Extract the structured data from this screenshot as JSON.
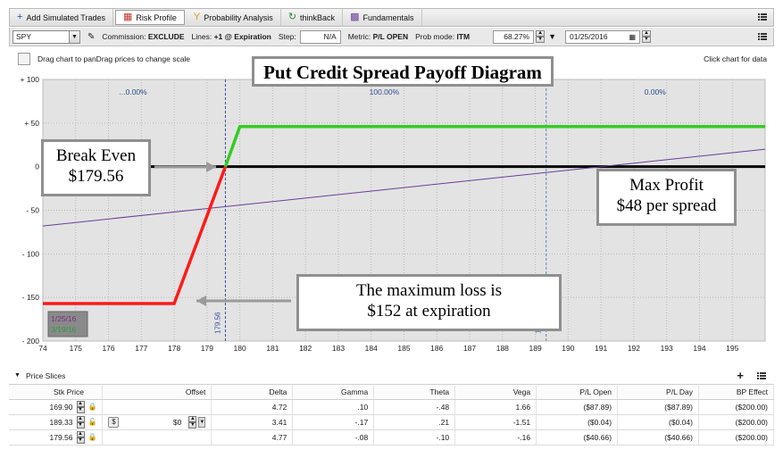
{
  "tabs": [
    {
      "label": "Add Simulated Trades",
      "icon": "plus-icon",
      "color": "#1f4fa8"
    },
    {
      "label": "Risk Profile",
      "icon": "risk-profile-icon",
      "color": "#c0392b"
    },
    {
      "label": "Probability Analysis",
      "icon": "probability-icon",
      "color": "#d4a017"
    },
    {
      "label": "thinkBack",
      "icon": "thinkback-icon",
      "color": "#2e8b3a"
    },
    {
      "label": "Fundamentals",
      "icon": "fundamentals-icon",
      "color": "#6a3d9a"
    }
  ],
  "toolbar": {
    "symbol": "SPY",
    "commission_label": "Commission:",
    "commission_value": "EXCLUDE",
    "lines_label": "Lines:",
    "lines_value": "+1 @ Expiration",
    "step_label": "Step:",
    "step_value": "N/A",
    "metric_label": "Metric:",
    "metric_value": "P/L OPEN",
    "prob_label": "Prob mode:",
    "prob_value": "ITM",
    "volatility": "68.27%",
    "date": "01/25/2016"
  },
  "chart_header": {
    "hint": "Drag chart to panDrag prices to change scale",
    "click_hint": "Click chart for data"
  },
  "callouts": {
    "title": "Put Credit Spread Payoff Diagram",
    "break_even_line1": "Break Even",
    "break_even_line2": "$179.56",
    "max_profit_line1": "Max Profit",
    "max_profit_line2": "$48 per spread",
    "max_loss_line1": "The maximum loss is",
    "max_loss_line2": "$152 at expiration"
  },
  "chart_data": {
    "type": "line",
    "xlim": [
      174,
      196
    ],
    "ylim": [
      -200,
      100
    ],
    "x_ticks": [
      "74",
      "175",
      "176",
      "177",
      "178",
      "179",
      "180",
      "181",
      "182",
      "183",
      "184",
      "185",
      "186",
      "187",
      "188",
      "189",
      "190",
      "191",
      "192",
      "193",
      "194",
      "195"
    ],
    "x_tick_values": [
      174,
      175,
      176,
      177,
      178,
      179,
      180,
      181,
      182,
      183,
      184,
      185,
      186,
      187,
      188,
      189,
      190,
      191,
      192,
      193,
      194,
      195
    ],
    "y_ticks": [
      "+ 100",
      "+ 50",
      "0",
      "- 50",
      "- 100",
      "- 150",
      "- 200"
    ],
    "y_tick_values": [
      100,
      50,
      0,
      -50,
      -100,
      -150,
      -200
    ],
    "regions": [
      {
        "label": "...0.00%",
        "from": 174,
        "to": 179.5
      },
      {
        "label": "100.00%",
        "from": 179.5,
        "to": 189.3
      },
      {
        "label": "0.00%",
        "from": 189.3,
        "to": 196
      }
    ],
    "vlines": [
      {
        "x": 179.56,
        "label": "179.56",
        "color": "#3a4fa0"
      },
      {
        "x": 189.33,
        "label": "1",
        "color": "#5a86b8"
      }
    ],
    "series": [
      {
        "color": "#ff1a1a",
        "x": [
          174,
          178,
          179.56
        ],
        "y": [
          -157,
          -157,
          0
        ]
      },
      {
        "color": "#33cc22",
        "x": [
          179.56,
          180,
          196
        ],
        "y": [
          0,
          46,
          46
        ]
      },
      {
        "color": "#6a3d9a",
        "x": [
          174,
          196
        ],
        "y": [
          -68,
          20
        ]
      }
    ],
    "zero_line_color": "#000000",
    "grid": true,
    "legend": [
      {
        "label": "1/25/16",
        "color": "#7a2a8a"
      },
      {
        "label": "3/19/16",
        "color": "#2e9a3a"
      }
    ],
    "legend_placement": "bottom-left",
    "plot_bg": "#e3e3e3"
  },
  "price_slices": {
    "title": "Price Slices",
    "columns": [
      "Stk Price",
      "Offset",
      "Delta",
      "Gamma",
      "Theta",
      "Vega",
      "P/L Open",
      "P/L Day",
      "BP Effect"
    ],
    "rows": [
      {
        "stk": "169.90",
        "offset": "",
        "delta": "4.72",
        "gamma": ".10",
        "theta": "-.48",
        "vega": "1.66",
        "pl_open": "($87.89)",
        "pl_day": "($87.89)",
        "bp": "($200.00)"
      },
      {
        "stk": "189.33",
        "offset": "$0",
        "delta": "3.41",
        "gamma": "-.17",
        "theta": ".21",
        "vega": "-1.51",
        "pl_open": "($0.04)",
        "pl_day": "($0.04)",
        "bp": "($200.00)"
      },
      {
        "stk": "179.56",
        "offset": "",
        "delta": "4.77",
        "gamma": "-.08",
        "theta": "-.10",
        "vega": "-.16",
        "pl_open": "($40.66)",
        "pl_day": "($40.66)",
        "bp": "($200.00)"
      }
    ]
  }
}
